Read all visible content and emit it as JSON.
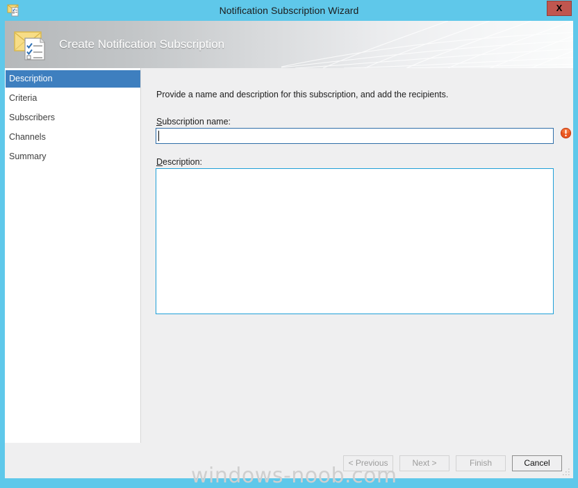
{
  "window": {
    "title": "Notification Subscription Wizard",
    "close_label": "X",
    "title_icon": "envelope-checklist-icon",
    "titlebar_color": "#5fc8ea",
    "close_button_color": "#c0564f"
  },
  "banner": {
    "heading": "Create Notification Subscription",
    "icon": "envelope-checklist-icon"
  },
  "sidebar": {
    "items": [
      {
        "label": "Description",
        "selected": true
      },
      {
        "label": "Criteria",
        "selected": false
      },
      {
        "label": "Subscribers",
        "selected": false
      },
      {
        "label": "Channels",
        "selected": false
      },
      {
        "label": "Summary",
        "selected": false
      }
    ],
    "selected_color": "#3e7fbf"
  },
  "content": {
    "intro": "Provide a name and description for this subscription, and add the recipients.",
    "name_label_prefix": "",
    "name_label_accel": "S",
    "name_label_suffix": "ubscription name:",
    "name_value": "",
    "name_placeholder": "",
    "desc_label_accel": "D",
    "desc_label_suffix": "escription:",
    "desc_value": "",
    "desc_placeholder": "",
    "error_icon": "error-exclamation-icon",
    "error_color": "#d94a22"
  },
  "footer": {
    "previous_label": "< Previous",
    "next_label": "Next >",
    "finish_label": "Finish",
    "cancel_label": "Cancel"
  },
  "watermark": {
    "text": "windows-noob.com"
  }
}
